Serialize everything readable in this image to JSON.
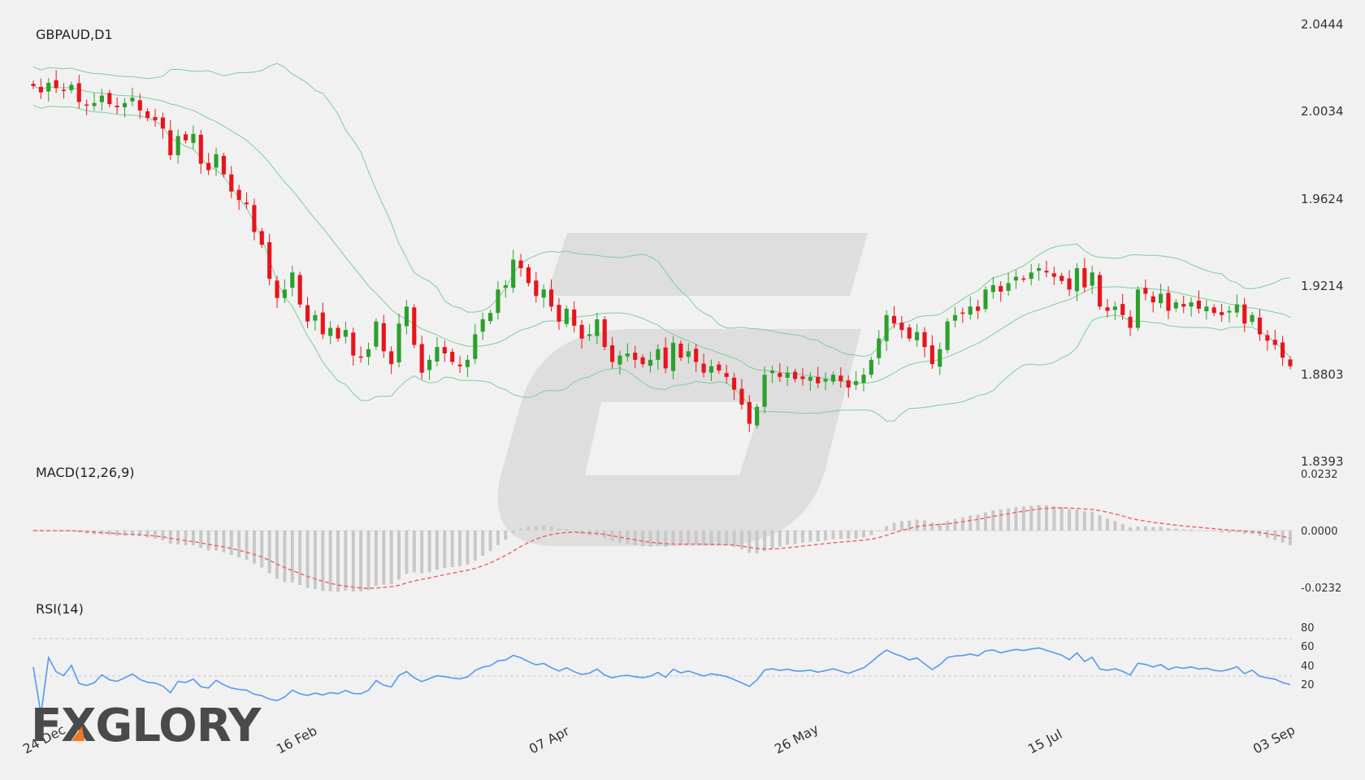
{
  "chart_data": {
    "type": "candlestick",
    "symbol_label": "GBPAUD,D1",
    "colors": {
      "up": "#2ca02c",
      "down": "#e8141c",
      "bands": "#7ccf9a",
      "macd_signal": "#f06060",
      "histogram": "#c8c8c8",
      "rsi": "#5599ee"
    },
    "price_axis": {
      "ticks": [
        "2.0444",
        "2.0034",
        "1.9624",
        "1.9214",
        "1.8803",
        "1.8393"
      ],
      "range": [
        1.8393,
        2.0444
      ]
    },
    "x_axis": {
      "labels": [
        "24 Dec",
        "16 Feb",
        "07 Apr",
        "26 May",
        "15 Jul",
        "03 Sep"
      ]
    },
    "close": [
      2.0155,
      2.0125,
      2.017,
      2.0145,
      2.0135,
      2.016,
      2.008,
      2.0065,
      2.0075,
      2.011,
      2.007,
      2.0055,
      2.0075,
      2.01,
      2.004,
      2.0005,
      1.9995,
      1.9955,
      1.983,
      1.992,
      1.99,
      1.993,
      1.979,
      1.976,
      1.9835,
      1.974,
      1.966,
      1.962,
      1.96,
      1.947,
      1.941,
      1.925,
      1.916,
      1.92,
      1.928,
      1.913,
      1.905,
      1.908,
      1.899,
      1.902,
      1.897,
      1.901,
      1.889,
      1.888,
      1.892,
      1.905,
      1.891,
      1.885,
      1.904,
      1.912,
      1.894,
      1.881,
      1.887,
      1.893,
      1.89,
      1.886,
      1.884,
      1.887,
      1.899,
      1.906,
      1.909,
      1.92,
      1.922,
      1.934,
      1.93,
      1.923,
      1.917,
      1.92,
      1.912,
      1.905,
      1.911,
      1.903,
      1.897,
      1.899,
      1.906,
      1.893,
      1.886,
      1.889,
      1.89,
      1.887,
      1.885,
      1.887,
      1.892,
      1.883,
      1.895,
      1.888,
      1.891,
      1.886,
      1.881,
      1.884,
      1.882,
      1.879,
      1.873,
      1.866,
      1.857,
      1.865,
      1.88,
      1.882,
      1.879,
      1.881,
      1.878,
      1.878,
      1.879,
      1.876,
      1.878,
      1.88,
      1.877,
      1.874,
      1.877,
      1.88,
      1.887,
      1.897,
      1.908,
      1.904,
      1.901,
      1.897,
      1.9,
      1.893,
      1.885,
      1.892,
      1.905,
      1.908,
      1.909,
      1.912,
      1.91,
      1.92,
      1.922,
      1.919,
      1.923,
      1.926,
      1.925,
      1.928,
      1.93,
      1.928,
      1.926,
      1.924,
      1.92,
      1.93,
      1.921,
      1.928,
      1.912,
      1.91,
      1.912,
      1.908,
      1.902,
      1.92,
      1.918,
      1.914,
      1.918,
      1.91,
      1.914,
      1.912,
      1.914,
      1.911,
      1.912,
      1.909,
      1.908,
      1.91,
      1.913,
      1.904,
      1.908,
      1.899,
      1.896,
      1.894,
      1.888,
      1.884
    ],
    "macd": {
      "label": "MACD(12,26,9)",
      "ticks": [
        "0.0232",
        "0.0000",
        "-0.0232"
      ],
      "range": [
        -0.0232,
        0.0232
      ]
    },
    "rsi": {
      "label": "RSI(14)",
      "ticks": [
        "80",
        "60",
        "40",
        "20"
      ],
      "levels": [
        70,
        30
      ],
      "range": [
        0,
        100
      ]
    }
  },
  "brand": {
    "text": "FXGLORY"
  }
}
